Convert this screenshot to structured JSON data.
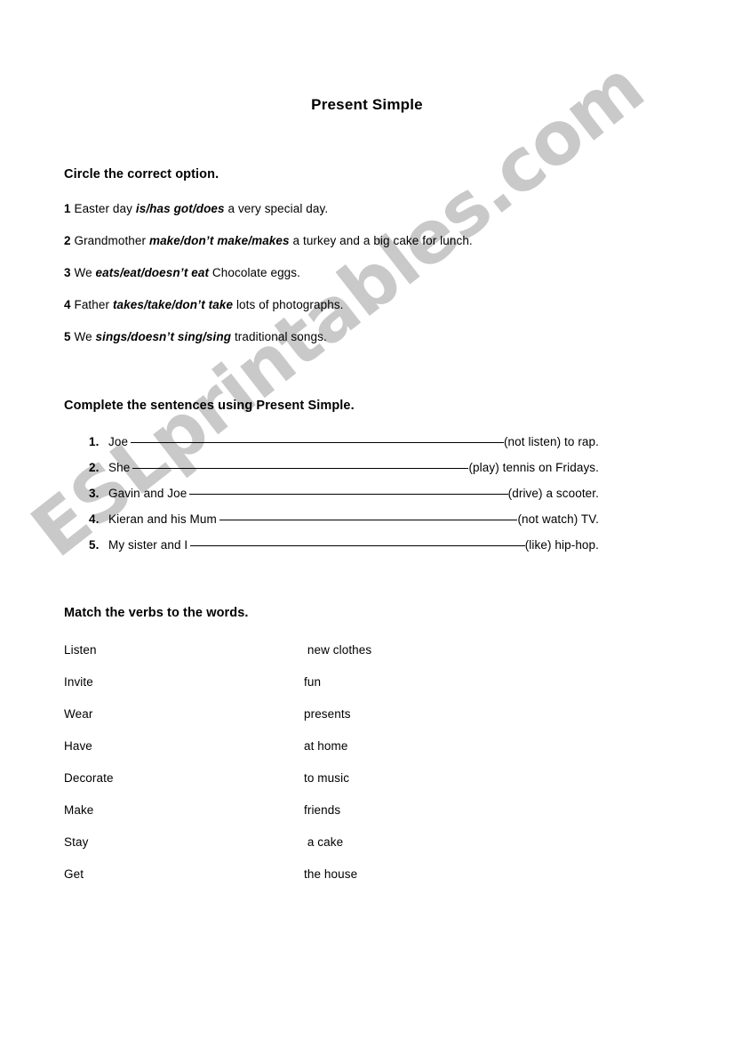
{
  "document": {
    "title": "Present Simple"
  },
  "watermark": {
    "text": "ESLprintables.com",
    "color": "#c9c9c9",
    "angle_deg": -38
  },
  "exercise1": {
    "heading": "Circle the correct option.",
    "items": [
      {
        "number": "1",
        "before": "Easter day ",
        "options": "is/has got/does",
        "after": " a very special day."
      },
      {
        "number": "2",
        "before": "Grandmother ",
        "options": "make/don’t make/makes",
        "after": " a turkey and a big cake for lunch."
      },
      {
        "number": "3",
        "before": "We ",
        "options": "eats/eat/doesn’t eat",
        "after": " Chocolate eggs."
      },
      {
        "number": "4",
        "before": "Father ",
        "options": "takes/take/don’t take",
        "after": " lots of photographs."
      },
      {
        "number": "5",
        "before": "We ",
        "options": "sings/doesn’t sing/sing",
        "after": " traditional songs."
      }
    ]
  },
  "exercise2": {
    "heading": "Complete the sentences using Present Simple.",
    "items": [
      {
        "number": "1.",
        "subject": "Joe",
        "cue": "(not listen) to rap."
      },
      {
        "number": "2.",
        "subject": "She",
        "cue": "(play) tennis on Fridays."
      },
      {
        "number": "3.",
        "subject": "Gavin and Joe",
        "cue": "(drive) a scooter."
      },
      {
        "number": "4.",
        "subject": "Kieran and his Mum",
        "cue": "(not watch) TV."
      },
      {
        "number": "5.",
        "subject": "My sister and I",
        "cue": "(like) hip-hop."
      }
    ]
  },
  "exercise3": {
    "heading": "Match the verbs to the words.",
    "verbs": [
      "Listen",
      "Invite",
      "Wear",
      "Have",
      "Decorate",
      "Make",
      "Stay",
      "Get"
    ],
    "words": [
      " new clothes",
      "fun",
      "presents",
      "at home",
      "to music",
      "friends",
      " a cake",
      "the house"
    ]
  }
}
